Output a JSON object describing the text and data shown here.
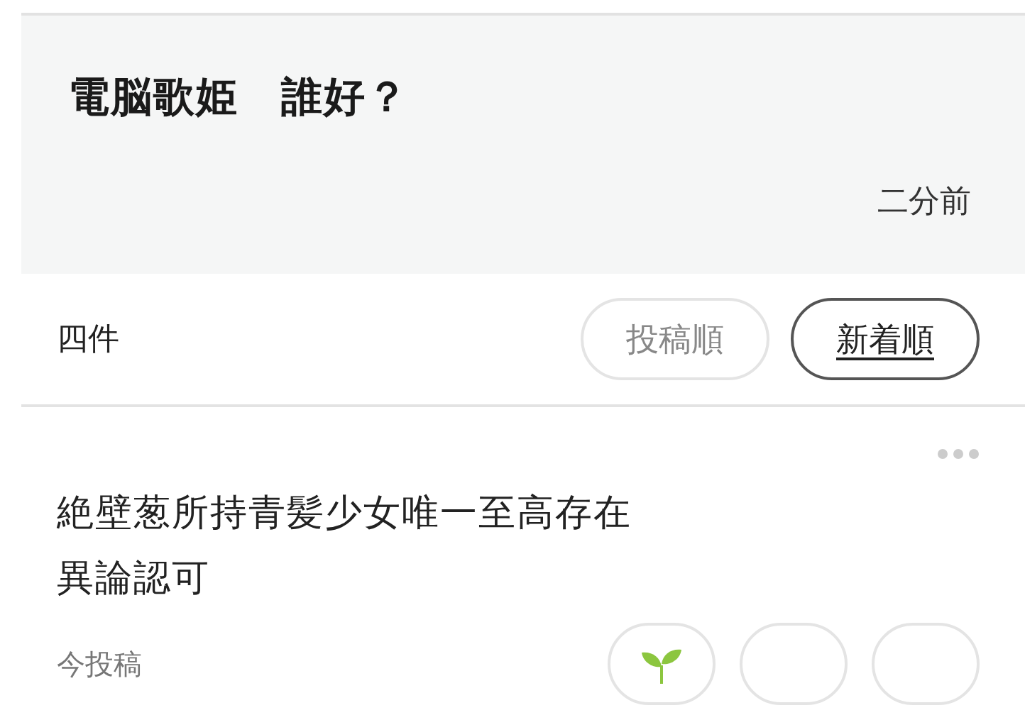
{
  "header": {
    "title": "電脳歌姫　誰好？",
    "time": "二分前"
  },
  "sort_bar": {
    "count": "四件",
    "options": [
      {
        "label": "投稿順",
        "selected": false
      },
      {
        "label": "新着順",
        "selected": true
      }
    ]
  },
  "post": {
    "lines": [
      "絶壁葱所持青髪少女唯一至高存在",
      "異論認可"
    ],
    "meta": "今投稿",
    "reactions": [
      {
        "kind": "sprout"
      },
      {
        "kind": "blank"
      },
      {
        "kind": "blank"
      }
    ]
  }
}
